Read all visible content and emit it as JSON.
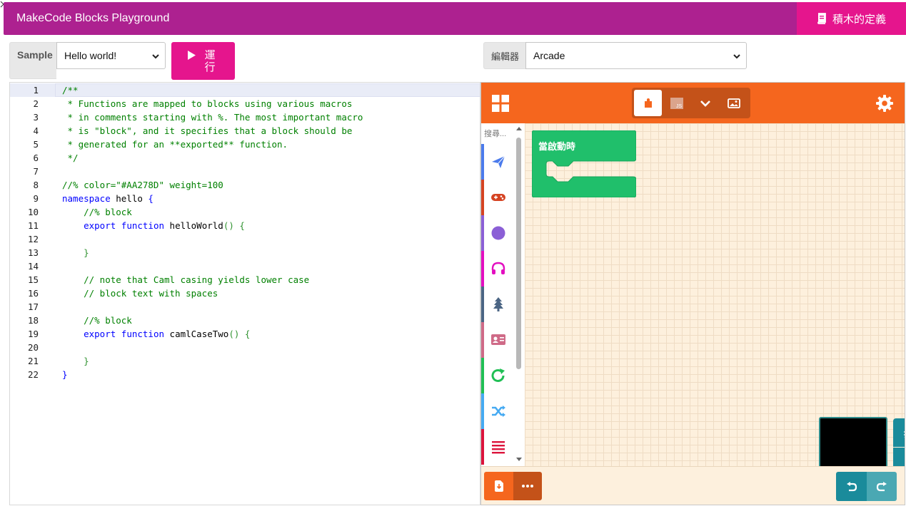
{
  "header": {
    "title": "MakeCode Blocks Playground",
    "definitions_button": "積木的定義"
  },
  "controls": {
    "sample_label": "Sample",
    "sample_value": "Hello world!",
    "run_label": "運行",
    "editor_label": "編輯器",
    "editor_value": "Arcade"
  },
  "code": {
    "lines": [
      [
        {
          "t": "/**",
          "c": "cm"
        }
      ],
      [
        {
          "t": " * Functions are mapped to blocks using various macros",
          "c": "cm"
        }
      ],
      [
        {
          "t": " * in comments starting with %. The most important macro",
          "c": "cm"
        }
      ],
      [
        {
          "t": " * is \"block\", and it specifies that a block should be",
          "c": "cm"
        }
      ],
      [
        {
          "t": " * generated for an **exported** function.",
          "c": "cm"
        }
      ],
      [
        {
          "t": " */",
          "c": "cm"
        }
      ],
      [],
      [
        {
          "t": "//% color=\"#AA278D\" weight=100",
          "c": "cm"
        }
      ],
      [
        {
          "t": "namespace",
          "c": "kw"
        },
        {
          "t": " hello ",
          "c": "tx"
        },
        {
          "t": "{",
          "c": "kw"
        }
      ],
      [
        {
          "t": "    //% block",
          "c": "cm"
        }
      ],
      [
        {
          "t": "    ",
          "c": "tx"
        },
        {
          "t": "export",
          "c": "kw"
        },
        {
          "t": " ",
          "c": "tx"
        },
        {
          "t": "function",
          "c": "kw"
        },
        {
          "t": " helloWorld",
          "c": "tx"
        },
        {
          "t": "() {",
          "c": "pn"
        }
      ],
      [],
      [
        {
          "t": "    }",
          "c": "pn"
        }
      ],
      [],
      [
        {
          "t": "    // note that Caml casing yields lower case",
          "c": "cm"
        }
      ],
      [
        {
          "t": "    // block text with spaces",
          "c": "cm"
        }
      ],
      [],
      [
        {
          "t": "    //% block",
          "c": "cm"
        }
      ],
      [
        {
          "t": "    ",
          "c": "tx"
        },
        {
          "t": "export",
          "c": "kw"
        },
        {
          "t": " ",
          "c": "tx"
        },
        {
          "t": "function",
          "c": "kw"
        },
        {
          "t": " camlCaseTwo",
          "c": "tx"
        },
        {
          "t": "() {",
          "c": "pn"
        }
      ],
      [],
      [
        {
          "t": "    }",
          "c": "pn"
        }
      ],
      [
        {
          "t": "}",
          "c": "kw"
        }
      ]
    ],
    "active_line": 1
  },
  "blocks": {
    "search_placeholder": "搜尋...",
    "start_block_label": "當啟動時",
    "categories": [
      {
        "name": "sprites-icon",
        "color": "#4b7bec"
      },
      {
        "name": "controller-icon",
        "color": "#d54322"
      },
      {
        "name": "game-icon",
        "color": "#8b5fd6"
      },
      {
        "name": "music-icon",
        "color": "#e30fc0"
      },
      {
        "name": "scene-icon",
        "color": "#4b6584"
      },
      {
        "name": "info-icon",
        "color": "#cf6a87"
      },
      {
        "name": "loops-icon",
        "color": "#20bf55"
      },
      {
        "name": "logic-icon",
        "color": "#45aaf2"
      },
      {
        "name": "variables-icon",
        "color": "#dc143c"
      }
    ],
    "colors": {
      "header": "#f5661e",
      "start_block": "#20bf6b",
      "sim_button": "#1a8b9b"
    }
  }
}
